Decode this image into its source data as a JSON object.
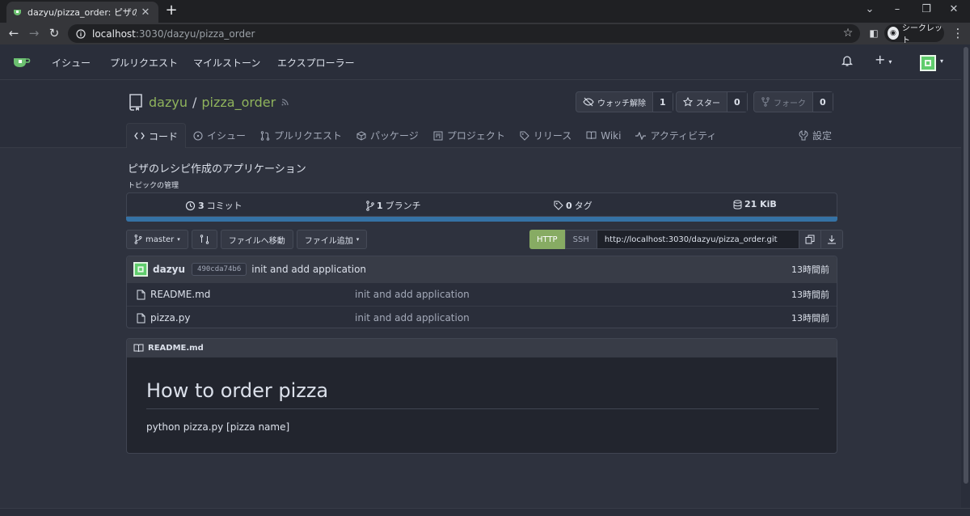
{
  "browser": {
    "tab_title": "dazyu/pizza_order: ピザのレシピ作成のアプリケーション",
    "url_host": "localhost",
    "url_rest": ":3030/dazyu/pizza_order",
    "profile_label": "シークレット"
  },
  "navbar": {
    "items": [
      "イシュー",
      "プルリクエスト",
      "マイルストーン",
      "エクスプローラー"
    ],
    "plus": "+"
  },
  "repo": {
    "owner": "dazyu",
    "separator": "/",
    "name": "pizza_order",
    "watch_label": "ウォッチ解除",
    "watch_count": "1",
    "star_label": "スター",
    "star_count": "0",
    "fork_label": "フォーク",
    "fork_count": "0",
    "tabs": [
      "コード",
      "イシュー",
      "プルリクエスト",
      "パッケージ",
      "プロジェクト",
      "リリース",
      "Wiki",
      "アクティビティ"
    ],
    "settings": "設定",
    "description": "ピザのレシピ作成のアプリケーション",
    "topics": "トピックの管理"
  },
  "stats": {
    "commits_num": "3",
    "commits_label": "コミット",
    "branches_num": "1",
    "branches_label": "ブランチ",
    "tags_num": "0",
    "tags_label": "タグ",
    "size": "21 KiB",
    "language_color": "#3572a5"
  },
  "toolbar": {
    "branch": "master",
    "goto_file": "ファイルへ移動",
    "add_file": "ファイル追加",
    "http": "HTTP",
    "ssh": "SSH",
    "clone_url": "http://localhost:3030/dazyu/pizza_order.git"
  },
  "latest_commit": {
    "author": "dazyu",
    "sha": "490cda74b6",
    "message": "init and add application",
    "ago": "13時間前"
  },
  "files": [
    {
      "name": "README.md",
      "message": "init and add application",
      "ago": "13時間前"
    },
    {
      "name": "pizza.py",
      "message": "init and add application",
      "ago": "13時間前"
    }
  ],
  "readme": {
    "file": "README.md",
    "heading": "How to order pizza",
    "body": "python pizza.py [pizza name]"
  }
}
